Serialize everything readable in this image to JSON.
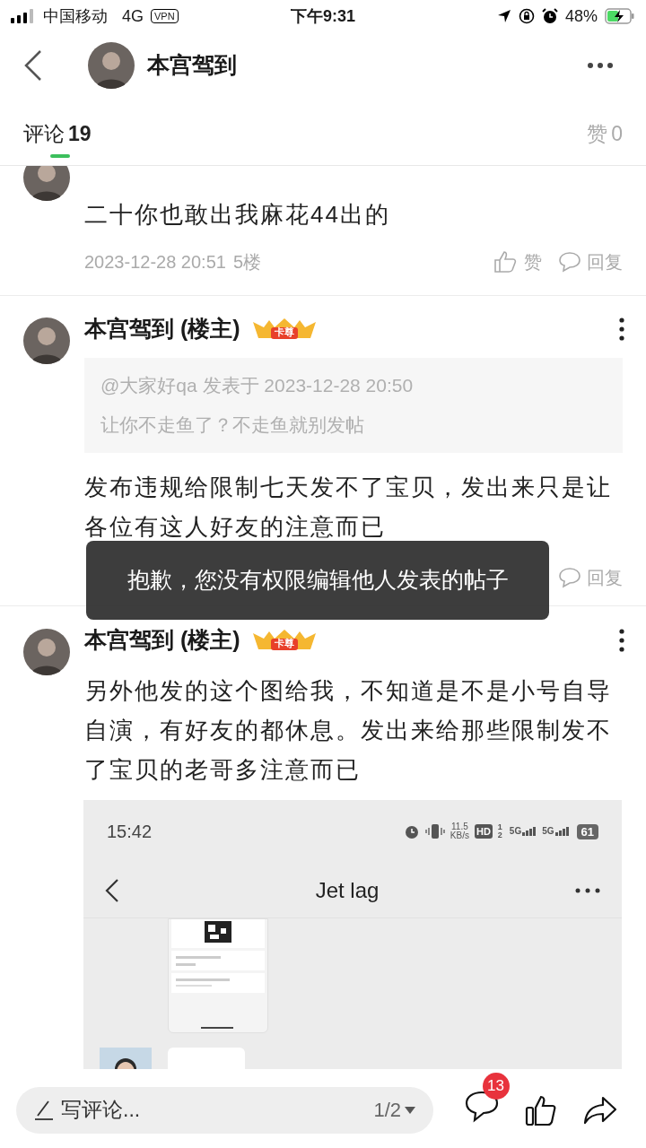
{
  "status_bar": {
    "carrier": "中国移动",
    "network": "4G",
    "vpn": "VPN",
    "time": "下午9:31",
    "battery": "48%"
  },
  "header": {
    "title": "本宫驾到"
  },
  "tabs": [
    {
      "label": "评论",
      "count": "19",
      "selected": true
    },
    {
      "label": "赞",
      "count": "0",
      "selected": false
    }
  ],
  "comments": [
    {
      "kind": "plain",
      "text": "二十你也敢出我麻花44出的",
      "date": "2023-12-28 20:51",
      "floor": "5楼",
      "like": "赞",
      "reply": "回复"
    },
    {
      "kind": "quote",
      "author": "本宫驾到 (楼主)",
      "badge": "卡尊",
      "quote_meta": "@大家好qa 发表于 2023-12-28 20:50",
      "quote_text": "让你不走鱼了？不走鱼就别发帖",
      "text": "发布违规给限制七天发不了宝贝，发出来只是让各位有这人好友的注意而已",
      "reply": "回复"
    },
    {
      "author": "本宫驾到 (楼主)",
      "badge": "卡尊",
      "text": "另外他发的这个图给我，不知道是不是小号自导自演，有好友的都休息。发出来给那些限制发不了宝贝的老哥多注意而已",
      "screenshot": {
        "time": "15:42",
        "speed": "11.5",
        "speed_unit": "KB/s",
        "hd": "HD",
        "sim1": "1",
        "sim2": "2",
        "net1": "5G",
        "net2": "5G",
        "battery": "61",
        "title": "Jet lag"
      }
    }
  ],
  "toast": "抱歉，您没有权限编辑他人发表的帖子",
  "bottom_bar": {
    "placeholder": "写评论...",
    "page": "1/2",
    "badge": "13"
  }
}
